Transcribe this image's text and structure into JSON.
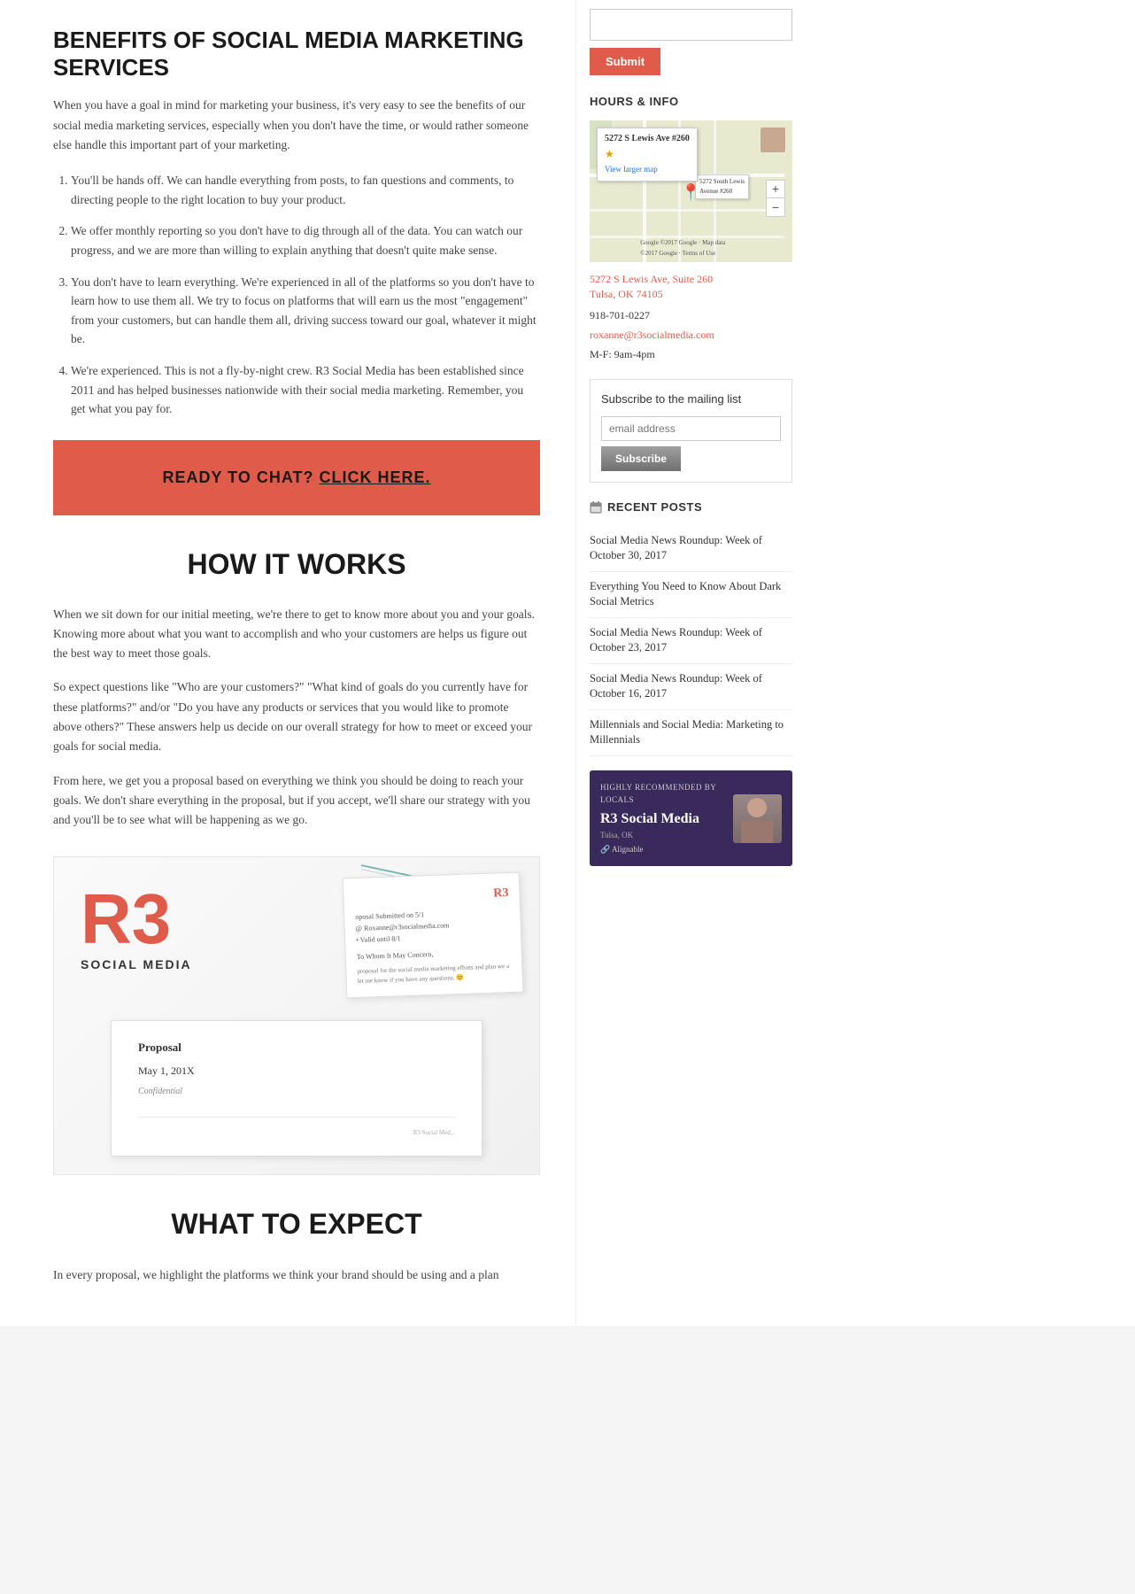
{
  "main": {
    "section1": {
      "title": "BENEFITS OF SOCIAL MEDIA MARKETING SERVICES",
      "intro": "When you have a goal in mind for marketing your business, it's very easy to see the benefits of our social media marketing services, especially when you don't have the time, or would rather someone else handle this important part of your marketing.",
      "benefits": [
        "You'll be hands off. We can handle everything from posts, to fan questions and comments, to directing people to the right location to buy your product.",
        "We offer monthly reporting so you don't have to dig through all of the data. You can watch our progress, and we are more than willing to explain anything that doesn't quite make sense.",
        "You don't have to learn everything. We're experienced in all of the platforms so you don't have to learn how to use them all. We try to focus on platforms that will earn us the most \"engagement\" from your customers, but can handle them all, driving success toward our goal, whatever it might be.",
        "We're experienced. This is not a fly-by-night crew. R3 Social Media has been established since 2011 and has helped businesses nationwide with their social media marketing. Remember, you get what you pay for."
      ]
    },
    "cta": {
      "text": "READY TO CHAT?",
      "link_text": "CLICK HERE."
    },
    "section2": {
      "title": "HOW IT WORKS",
      "paragraphs": [
        "When we sit down for our initial meeting, we're there to get to know more about you and your goals. Knowing more about what you want to accomplish and who your customers are helps us figure out the best way to meet those goals.",
        "So expect questions like \"Who are your customers?\" \"What kind of goals do you currently have for these platforms?\" and/or \"Do you have any products or services that you would like to promote above others?\" These answers help us decide on our overall strategy for how to meet or exceed your goals for social media.",
        "From here, we get you a proposal based on everything we think you should be doing to reach your goals. We don't share everything in the proposal, but if you accept, we'll share our strategy with you and you'll be to see what will be happening as we go."
      ]
    },
    "proposal": {
      "logo_r3": "R",
      "logo_sub": "SOCIAL MEDIA",
      "paper_email": "@ Roxanne@r3socialmedia.com",
      "paper_valid": "• Valid until 8/1",
      "paper_submitted": "oposal Submitted on 5/1",
      "paper_whom": "To Whom It May Concern,",
      "paper_body": "proposal for the social media marketing efforts and plan we a let me know if you have any questions. 😊",
      "paper_title": "Proposal",
      "paper_date": "May 1, 201X",
      "paper_confidential": "Confidential"
    },
    "section3": {
      "title": "WHAT TO EXPECT",
      "text": "In every proposal, we highlight the platforms we think your brand should be using and a plan"
    }
  },
  "sidebar": {
    "submit_placeholder": "",
    "submit_label": "Submit",
    "hours_title": "HOURS & INFO",
    "map": {
      "address_line1": "5272 S Lewis Ave #260",
      "address_link": "View larger map",
      "pin_label1": "5272 South Lewis",
      "pin_label2": "Avenue #260"
    },
    "location": {
      "address1": "5272 S Lewis Ave, Suite 260",
      "address2": "Tulsa, OK 74105",
      "phone": "918-701-0227",
      "email": "roxanne@r3socialmedia.com",
      "hours": "M-F: 9am-4pm"
    },
    "mailing_list": {
      "title": "Subscribe to the mailing list",
      "placeholder": "email address",
      "button_label": "Subscribe"
    },
    "recent_posts_title": "RECENT POSTS",
    "recent_posts": [
      {
        "title": "Social Media News Roundup: Week of October 30, 2017"
      },
      {
        "title": "Everything You Need to Know About Dark Social Metrics"
      },
      {
        "title": "Social Media News Roundup: Week of October 23, 2017"
      },
      {
        "title": "Social Media News Roundup: Week of October 16, 2017"
      },
      {
        "title": "Millennials and Social Media: Marketing to Millennials"
      }
    ],
    "alignable": {
      "badge_title": "Highly Recommended by Locals",
      "company_name": "R3 Social Media",
      "location": "Tulsa, OK",
      "logo_text": "🔗 Alignable"
    }
  }
}
